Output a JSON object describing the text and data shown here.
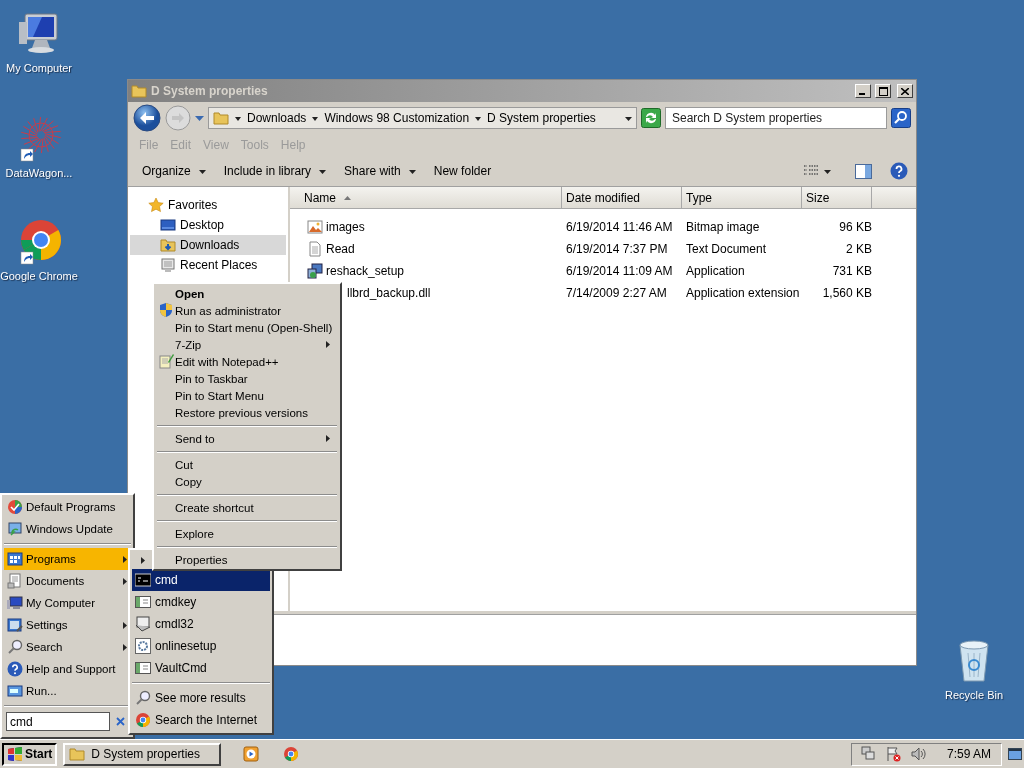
{
  "desktop_icons": [
    {
      "label": "My Computer",
      "kind": "computer"
    },
    {
      "label": "DataWagon...",
      "kind": "art"
    },
    {
      "label": "Google Chrome",
      "kind": "chrome"
    },
    {
      "label": "Recycle Bin",
      "kind": "recycle"
    }
  ],
  "window": {
    "title": "D System properties",
    "breadcrumbs": [
      "Downloads",
      "Windows 98 Customization",
      "D System properties"
    ],
    "search": {
      "placeholder": "Search D System properties"
    },
    "menu": [
      {
        "label": "File",
        "disabled": true
      },
      {
        "label": "Edit",
        "disabled": true
      },
      {
        "label": "View",
        "disabled": true
      },
      {
        "label": "Tools",
        "disabled": true
      },
      {
        "label": "Help",
        "disabled": true
      }
    ],
    "toolbar": [
      {
        "label": "Organize",
        "dropdown": true
      },
      {
        "label": "Include in library",
        "dropdown": true
      },
      {
        "label": "Share with",
        "dropdown": true
      },
      {
        "label": "New folder",
        "dropdown": false
      }
    ],
    "nav": [
      {
        "label": "Favorites",
        "kind": "favorites",
        "selected": false,
        "children": [
          {
            "label": "Desktop",
            "kind": "desktop",
            "selected": false
          },
          {
            "label": "Downloads",
            "kind": "downloads",
            "selected": true
          },
          {
            "label": "Recent Places",
            "kind": "recent",
            "selected": false
          }
        ]
      }
    ],
    "columns": [
      {
        "label": "Name",
        "sorted": true
      },
      {
        "label": "Date modified",
        "sorted": false
      },
      {
        "label": "Type",
        "sorted": false
      },
      {
        "label": "Size",
        "sorted": false
      }
    ],
    "rows": [
      {
        "name": "images",
        "date": "6/19/2014 11:46 AM",
        "type": "Bitmap image",
        "size": "96 KB",
        "kind": "image"
      },
      {
        "name": "Read",
        "date": "6/19/2014 7:37 PM",
        "type": "Text Document",
        "size": "2 KB",
        "kind": "text"
      },
      {
        "name": "reshack_setup",
        "date": "6/19/2014 11:09 AM",
        "type": "Application",
        "size": "731 KB",
        "kind": "setup"
      },
      {
        "name": "llbrd_backup.dll",
        "date": "7/14/2009 2:27 AM",
        "type": "Application extension",
        "size": "1,560 KB",
        "kind": "covered"
      }
    ]
  },
  "context_menu": {
    "items": [
      {
        "label": "Open",
        "kind": "default"
      },
      {
        "label": "Run as administrator",
        "kind": "shield"
      },
      {
        "label": "Pin to Start menu (Open-Shell)",
        "kind": "plain"
      },
      {
        "label": "7-Zip",
        "kind": "submenu"
      },
      {
        "label": "Edit with Notepad++",
        "kind": "notepad"
      },
      {
        "label": "Pin to Taskbar",
        "kind": "plain"
      },
      {
        "label": "Pin to Start Menu",
        "kind": "plain"
      },
      {
        "label": "Restore previous versions",
        "kind": "plain"
      },
      {
        "kind": "separator"
      },
      {
        "label": "Send to",
        "kind": "submenu"
      },
      {
        "kind": "separator"
      },
      {
        "label": "Cut",
        "kind": "plain"
      },
      {
        "label": "Copy",
        "kind": "plain"
      },
      {
        "kind": "separator"
      },
      {
        "label": "Create shortcut",
        "kind": "plain"
      },
      {
        "kind": "separator"
      },
      {
        "label": "Explore",
        "kind": "plain"
      },
      {
        "kind": "separator"
      },
      {
        "label": "Properties",
        "kind": "plain"
      }
    ]
  },
  "start_menu": {
    "items": [
      {
        "label": "Default Programs",
        "kind": "defaults",
        "submenu": false,
        "selected": false
      },
      {
        "label": "Windows Update",
        "kind": "update",
        "submenu": false,
        "selected": false
      },
      {
        "kind": "separator"
      },
      {
        "label": "Programs",
        "kind": "programs",
        "submenu": true,
        "selected": true
      },
      {
        "label": "Documents",
        "kind": "documents",
        "submenu": true,
        "selected": false
      },
      {
        "label": "My Computer",
        "kind": "computer",
        "submenu": false,
        "selected": false
      },
      {
        "label": "Settings",
        "kind": "settings",
        "submenu": true,
        "selected": false
      },
      {
        "label": "Search",
        "kind": "search",
        "submenu": true,
        "selected": false
      },
      {
        "label": "Help and Support",
        "kind": "help",
        "submenu": false,
        "selected": false
      },
      {
        "label": "Run...",
        "kind": "run",
        "submenu": false,
        "selected": false
      },
      {
        "kind": "separator"
      }
    ],
    "search": {
      "value": "cmd"
    }
  },
  "search_results": {
    "items": [
      {
        "kind": "folder_arrow",
        "selected": false
      },
      {
        "label": "cmd",
        "kind": "console",
        "selected": true
      },
      {
        "label": "cmdkey",
        "kind": "app",
        "selected": false
      },
      {
        "label": "cmdl32",
        "kind": "dialer",
        "selected": false
      },
      {
        "label": "onlinesetup",
        "kind": "gear",
        "selected": false
      },
      {
        "label": "VaultCmd",
        "kind": "app",
        "selected": false
      },
      {
        "kind": "separator"
      },
      {
        "label": "See more results",
        "kind": "search",
        "selected": false
      },
      {
        "label": "Search the Internet",
        "kind": "chrome",
        "selected": false
      }
    ]
  },
  "taskbar": {
    "start": "Start",
    "tasks": [
      {
        "label": "D System properties",
        "selected": false
      }
    ],
    "quick_launch": [
      {
        "kind": "media"
      },
      {
        "kind": "chrome"
      }
    ],
    "tray": [
      {
        "kind": "network"
      },
      {
        "kind": "flag"
      },
      {
        "kind": "volume"
      }
    ],
    "clock": "7:59 AM"
  }
}
